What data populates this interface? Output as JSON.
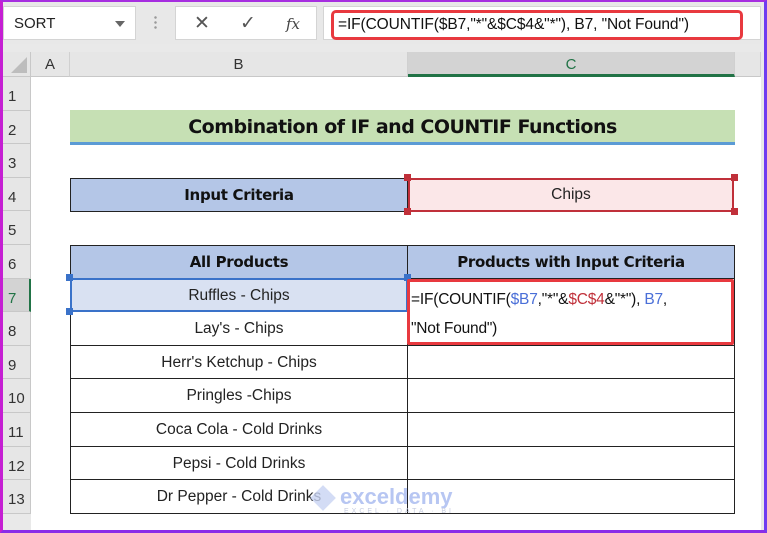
{
  "formula_bar": {
    "name_box": "SORT",
    "cancel_icon": "✕",
    "enter_icon": "✓",
    "fx_label": "fx",
    "formula": "=IF(COUNTIF($B7,\"*\"&$C$4&\"*\"), B7, \"Not Found\")"
  },
  "columns": [
    "A",
    "B",
    "C"
  ],
  "rows": [
    "1",
    "2",
    "3",
    "4",
    "5",
    "6",
    "7",
    "8",
    "9",
    "10",
    "11",
    "12",
    "13"
  ],
  "sheet": {
    "title": "Combination of IF and COUNTIF Functions",
    "criteria_label": "Input Criteria",
    "criteria_value": "Chips",
    "table_headers": [
      "All Products",
      "Products with Input Criteria"
    ],
    "products": [
      "Ruffles - Chips",
      "Lay's - Chips",
      "Herr's Ketchup - Chips",
      "Pringles -Chips",
      "Coca Cola - Cold Drinks",
      "Pepsi - Cold Drinks",
      "Dr Pepper - Cold Drinks"
    ],
    "editing_formula": {
      "p1": "=IF(COUNTIF(",
      "ref1": "$B7",
      "p2": ",\"*\"&",
      "ref2": "$C$4",
      "p3": "&\"*\"), ",
      "ref3": "B7",
      "p4": ",",
      "line2": "\"Not Found\")"
    }
  },
  "watermark": {
    "brand": "exceldemy",
    "tagline": "EXCEL · DATA · BI"
  },
  "colors": {
    "accent_green": "#217346",
    "title_fill": "#c6e0b4",
    "header_fill": "#b4c6e7",
    "criteria_fill": "#fbe7e8",
    "highlight_red": "#e8393f",
    "ref_blue": "#4a6fd8",
    "ref_red": "#c0303a"
  }
}
